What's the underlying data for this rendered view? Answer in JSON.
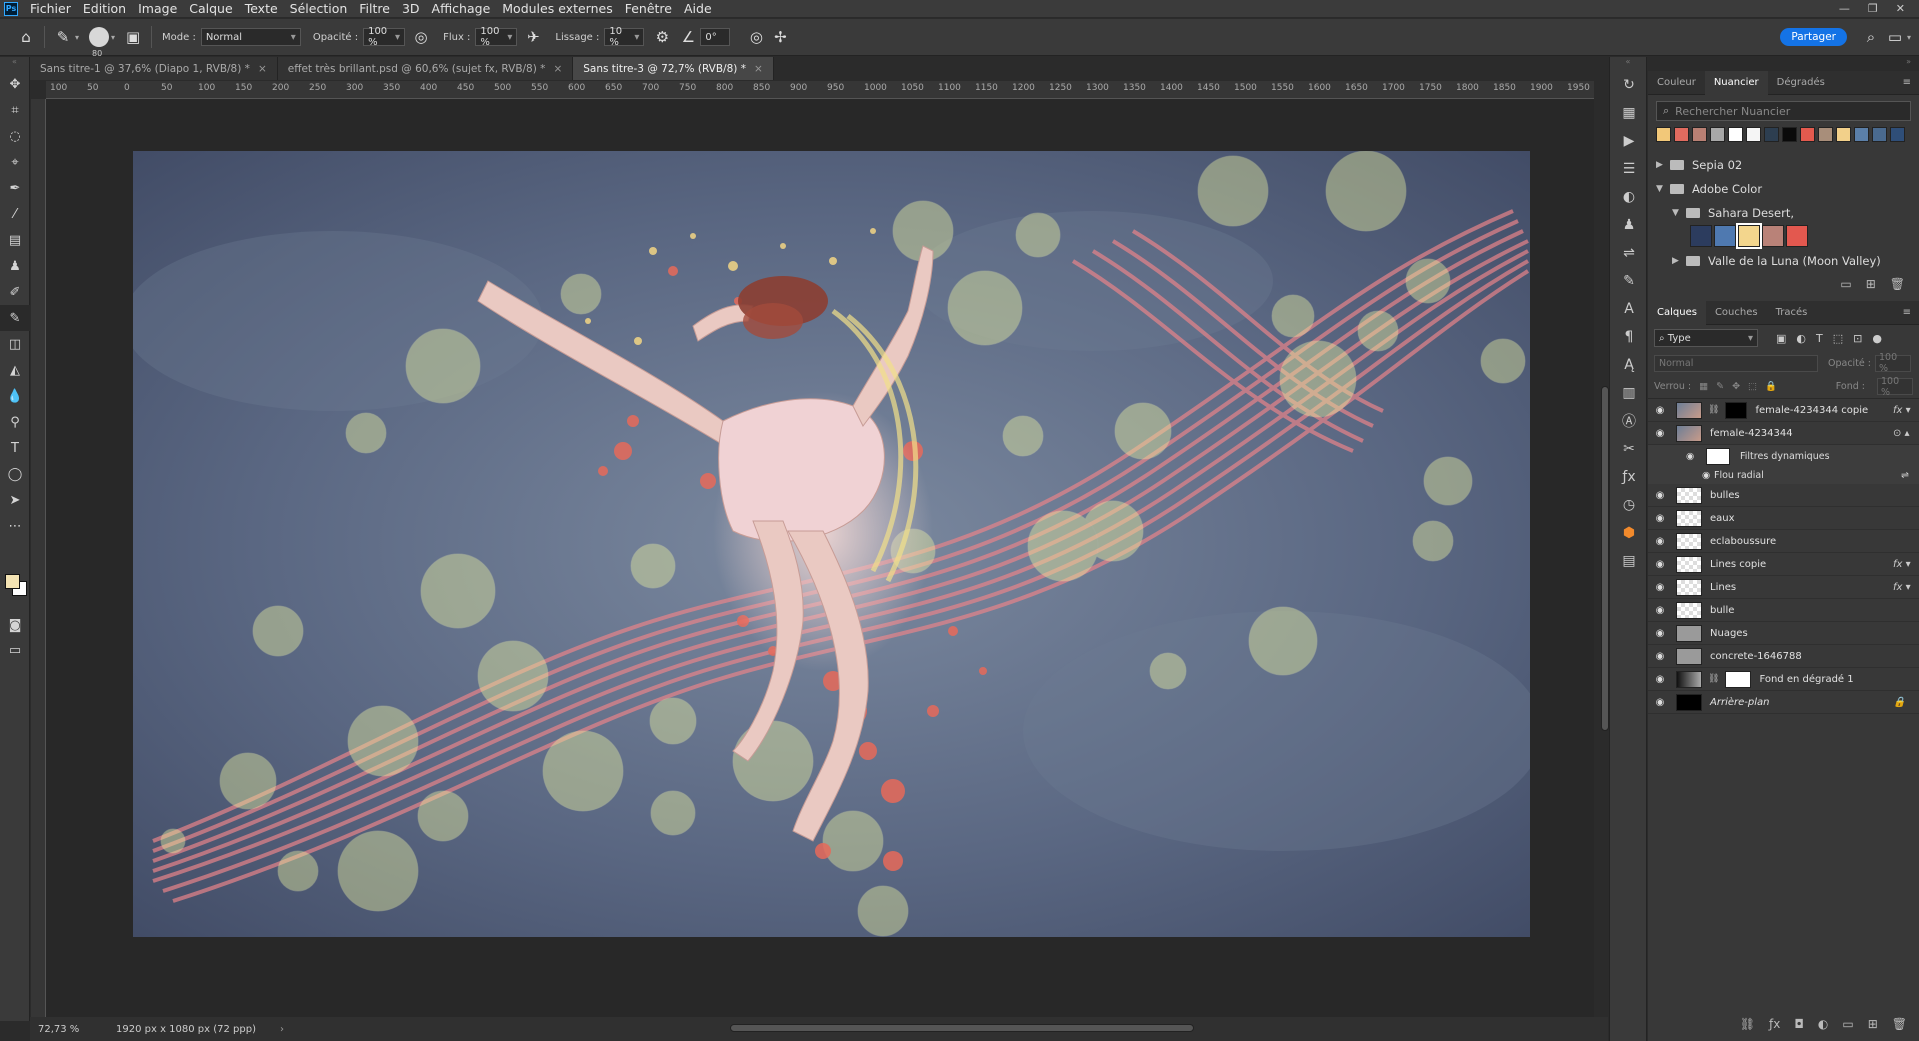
{
  "menu": [
    "Fichier",
    "Edition",
    "Image",
    "Calque",
    "Texte",
    "Sélection",
    "Filtre",
    "3D",
    "Affichage",
    "Modules externes",
    "Fenêtre",
    "Aide"
  ],
  "app_logo": "Ps",
  "options": {
    "brush_size": "80",
    "mode_label": "Mode :",
    "mode_value": "Normal",
    "opacity_label": "Opacité :",
    "opacity_value": "100 %",
    "flow_label": "Flux :",
    "flow_value": "100 %",
    "smoothing_label": "Lissage :",
    "smoothing_value": "10 %",
    "angle_value": "0°",
    "share": "Partager"
  },
  "tabs": [
    {
      "label": "Sans titre-1 @ 37,6% (Diapo 1, RVB/8) *",
      "active": false
    },
    {
      "label": "effet très brillant.psd @ 60,6% (sujet fx, RVB/8) *",
      "active": false
    },
    {
      "label": "Sans titre-3 @ 72,7% (RVB/8) *",
      "active": true
    }
  ],
  "ruler_marks": [
    "100",
    "50",
    "0",
    "50",
    "100",
    "150",
    "200",
    "250",
    "300",
    "350",
    "400",
    "450",
    "500",
    "550",
    "600",
    "650",
    "700",
    "750",
    "800",
    "850",
    "900",
    "950",
    "1000",
    "1050",
    "1100",
    "1150",
    "1200",
    "1250",
    "1300",
    "1350",
    "1400",
    "1450",
    "1500",
    "1550",
    "1600",
    "1650",
    "1700",
    "1750",
    "1800",
    "1850",
    "1900",
    "1950"
  ],
  "status": {
    "zoom": "72,73 %",
    "doc_info": "1920 px x 1080 px (72 ppp)"
  },
  "swatches_panel": {
    "tabs": [
      "Couleur",
      "Nuancier",
      "Dégradés"
    ],
    "active_tab": "Nuancier",
    "search_placeholder": "Rechercher Nuancier",
    "strip_colors": [
      "#f2c879",
      "#e06b5f",
      "#b98074",
      "#a8a8a8",
      "#ffffff",
      "#f5f5f5",
      "#2d3e50",
      "#0a0a0a",
      "#e35a4e",
      "#a88e7a",
      "#f2d08a",
      "#5b7fa8",
      "#4a6a8f",
      "#2f4e78"
    ],
    "groups": [
      {
        "name": "Sepia 02",
        "expanded": false
      },
      {
        "name": "Adobe Color",
        "expanded": true
      },
      {
        "name": "Sahara Desert,",
        "expanded": true
      },
      {
        "name": "Valle de la Luna (Moon Valley)",
        "expanded": false
      }
    ],
    "sahara_colors": [
      "#2c3c5e",
      "#4f79b0",
      "#f3d68d",
      "#b98278",
      "#e3584f"
    ]
  },
  "layers_panel": {
    "tabs": [
      "Calques",
      "Couches",
      "Tracés"
    ],
    "active_tab": "Calques",
    "filter_type": "Type",
    "blend_mode": "Normal",
    "opacity_label": "Opacité :",
    "opacity_value": "100 %",
    "lock_label": "Verrou :",
    "fill_label": "Fond :",
    "fill_value": "100 %",
    "layers": [
      {
        "name": "female-4234344 copie",
        "thumb": "photo",
        "fx": true
      },
      {
        "name": "female-4234344",
        "thumb": "photo",
        "fx": false
      },
      {
        "name": "bulles",
        "thumb": "checker",
        "fx": false
      },
      {
        "name": "eaux",
        "thumb": "checker",
        "fx": false
      },
      {
        "name": "eclaboussure",
        "thumb": "checker",
        "fx": false
      },
      {
        "name": "Lines copie",
        "thumb": "checker",
        "fx": true
      },
      {
        "name": "Lines",
        "thumb": "checker",
        "fx": true
      },
      {
        "name": "bulle",
        "thumb": "checker",
        "fx": false
      },
      {
        "name": "Nuages",
        "thumb": "gray",
        "fx": false
      },
      {
        "name": "concrete-1646788",
        "thumb": "gray",
        "fx": false
      },
      {
        "name": "Fond en dégradé 1",
        "thumb": "grad",
        "fx": false
      },
      {
        "name": "Arrière-plan",
        "thumb": "dark",
        "fx": false
      }
    ],
    "smart_filters_label": "Filtres dynamiques",
    "smart_filter_item": "Flou radial"
  }
}
